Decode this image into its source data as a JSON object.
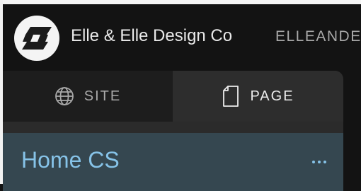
{
  "brand": {
    "name": "Elle & Elle Design Co",
    "handle": "ELLEANDE",
    "logo_icon": "stylized-s-logo-icon"
  },
  "tabs": [
    {
      "label": "SITE",
      "icon": "globe-icon",
      "active": false
    },
    {
      "label": "PAGE",
      "icon": "page-icon",
      "active": true
    }
  ],
  "page_item": {
    "title": "Home CS",
    "more_icon": "ellipsis-icon"
  },
  "colors": {
    "background": "#131313",
    "panel": "#2b2b2b",
    "inactive_tab": "#1d1d1d",
    "page_row": "#354750",
    "accent": "#86c3e8"
  }
}
